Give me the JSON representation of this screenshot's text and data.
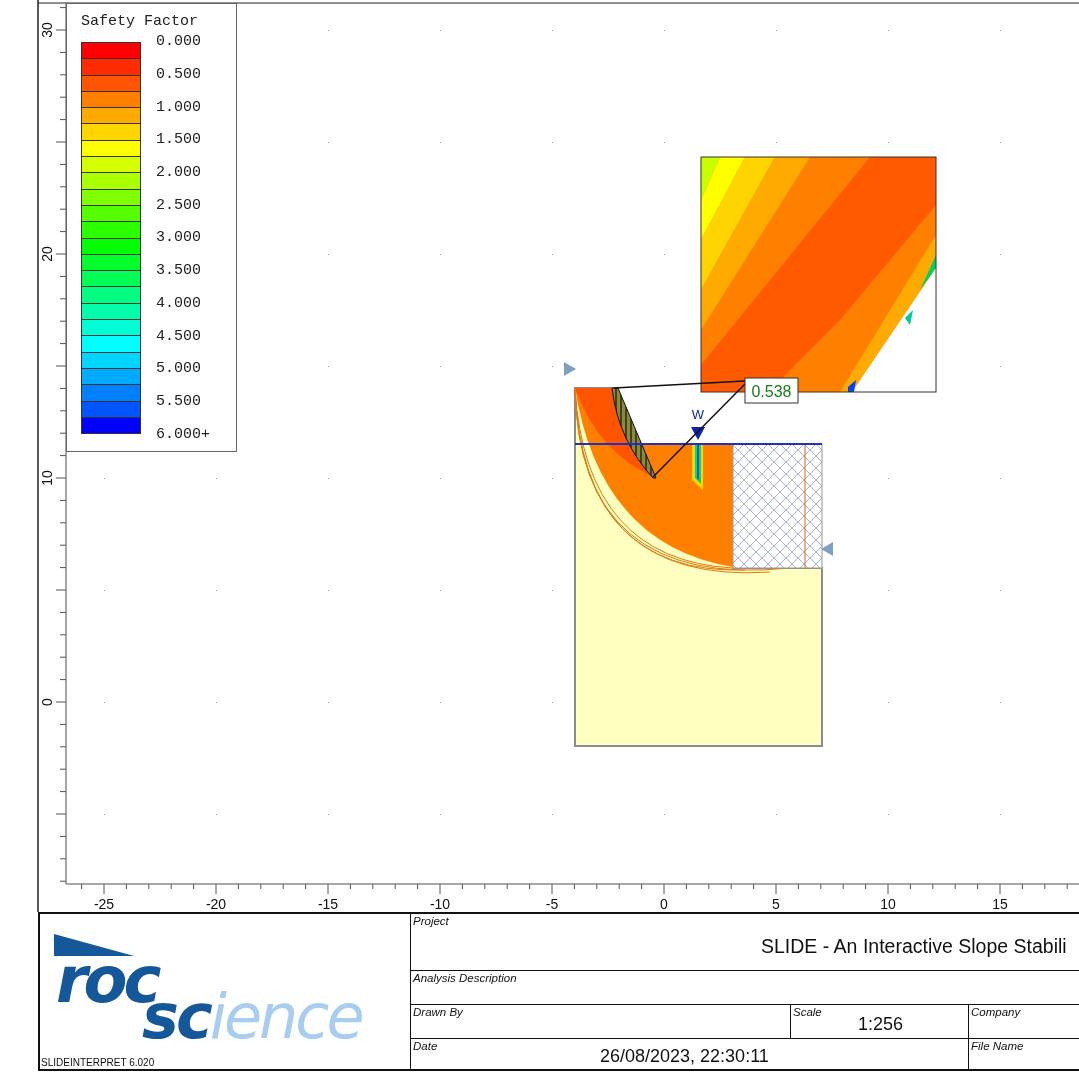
{
  "legend": {
    "title": "Safety Factor",
    "bands": [
      {
        "color": "#ff0000"
      },
      {
        "color": "#ff2b00"
      },
      {
        "color": "#ff5500"
      },
      {
        "color": "#ff8000"
      },
      {
        "color": "#ffaa00"
      },
      {
        "color": "#ffd500"
      },
      {
        "color": "#ffff00"
      },
      {
        "color": "#d5ff00"
      },
      {
        "color": "#aaff00"
      },
      {
        "color": "#80ff00"
      },
      {
        "color": "#55ff00"
      },
      {
        "color": "#2bff00"
      },
      {
        "color": "#00ff00"
      },
      {
        "color": "#00ff2b"
      },
      {
        "color": "#00ff55"
      },
      {
        "color": "#00ff80"
      },
      {
        "color": "#00ffaa"
      },
      {
        "color": "#00ffd5"
      },
      {
        "color": "#00ffff"
      },
      {
        "color": "#00d5ff"
      },
      {
        "color": "#00aaff"
      },
      {
        "color": "#0080ff"
      },
      {
        "color": "#0055ff"
      },
      {
        "color": "#0000ff"
      }
    ],
    "labels": [
      "0.000",
      "0.500",
      "1.000",
      "1.500",
      "2.000",
      "2.500",
      "3.000",
      "3.500",
      "4.000",
      "4.500",
      "5.000",
      "5.500",
      "6.000+"
    ]
  },
  "axes": {
    "x_ticks": [
      "-25",
      "-20",
      "-15",
      "-10",
      "-5",
      "0",
      "5",
      "10",
      "15"
    ],
    "y_ticks": [
      "30",
      "20",
      "10",
      "0"
    ]
  },
  "model": {
    "water_table_label": "W",
    "safety_factor": "0.538"
  },
  "title_block": {
    "logo": {
      "line_1": "roc",
      "line_2_dark": "sc",
      "line_2_light": "ience"
    },
    "version": "SLIDEINTERPRET 6.020",
    "fields": [
      {
        "label": "Project",
        "value": "SLIDE - An Interactive Slope Stabili"
      },
      {
        "label": "Analysis Description"
      },
      {
        "label": "Drawn By"
      },
      {
        "label": "Scale",
        "value": "1:256"
      },
      {
        "label": "Company"
      },
      {
        "label": "Date",
        "value": "26/08/2023, 22:30:11"
      },
      {
        "label": "File Name"
      }
    ]
  }
}
